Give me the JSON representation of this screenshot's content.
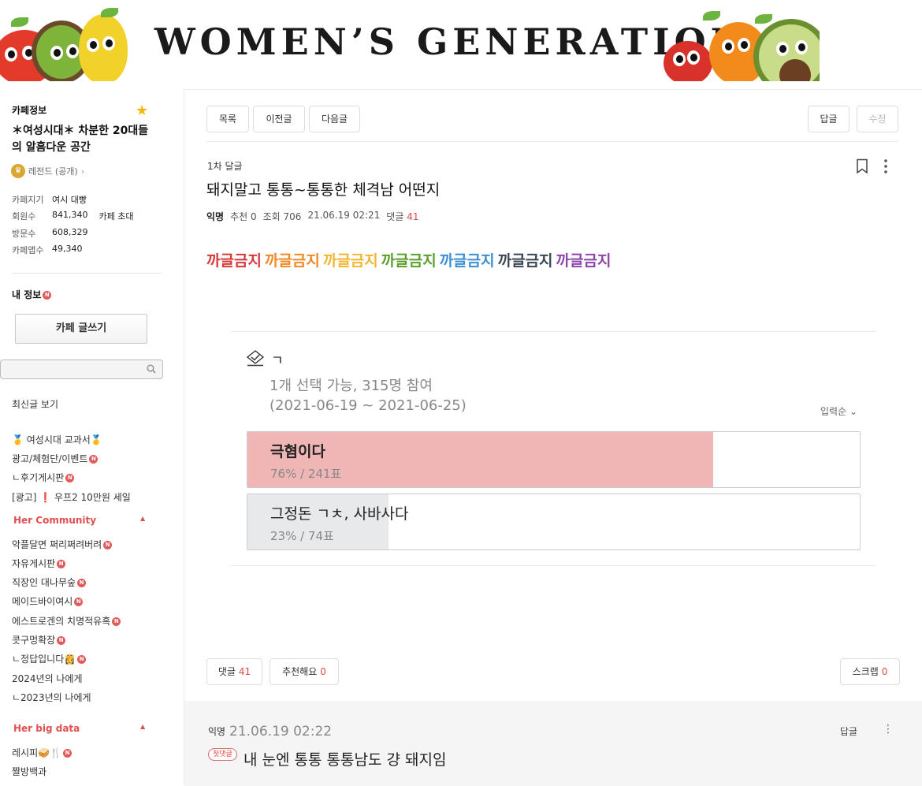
{
  "banner": {
    "title": "WOMEN’S GENERATION"
  },
  "sidebar": {
    "cafe_info_title": "카페정보",
    "cafe_desc": "＊여성시대＊ 차분한 20대들의 알흠다운 공간",
    "rank": "레전드 (공개)",
    "stats": [
      {
        "key": "카페지기",
        "value": "여시 대빵",
        "extra": ""
      },
      {
        "key": "회원수",
        "value": "841,340",
        "extra": "카페 초대"
      },
      {
        "key": "방문수",
        "value": "608,329",
        "extra": ""
      },
      {
        "key": "카페앱수",
        "value": "49,340",
        "extra": ""
      }
    ],
    "my_info": "내 정보",
    "write_button": "카페 글쓰기",
    "search_placeholder": "",
    "recent_posts": "최신글 보기",
    "links_top": [
      "🥇 여성시대 교과서🥇",
      "광고/체험단/이벤트",
      "ㄴ후기게시판",
      "[광고] ❗ 우프2 10만원 세일"
    ],
    "group1": "Her Community",
    "links_community": [
      "악플달면 쩌리쩌려버려",
      "자유게시판",
      "직장인 대나무숲",
      "메이드바이여시",
      "에스트로겐의 치명적유혹",
      "콧구멍확장",
      "ㄴ정답입니다👸",
      "2024년의 나에게",
      "ㄴ2023년의 나에게"
    ],
    "group2": "Her big data",
    "links_bigdata": [
      "레시피🥪🍴",
      "짤방백과"
    ]
  },
  "toolbar": {
    "list": "목록",
    "prev": "이전글",
    "next": "다음글",
    "reply": "답글",
    "edit": "수정"
  },
  "post": {
    "board": "1차 달글",
    "title": "돼지말고 통통~통통한 체격남 어떤지",
    "author": "익명",
    "recommend": "추천 0",
    "views": "조회 706",
    "date": "21.06.19 02:21",
    "comments_label": "댓글",
    "comments_count": "41",
    "rainbow": [
      {
        "text": "까글금지",
        "color": "#d9383a"
      },
      {
        "text": "까글금지",
        "color": "#f08a24"
      },
      {
        "text": "까글금지",
        "color": "#f2b630"
      },
      {
        "text": "까글금지",
        "color": "#5a9e2d"
      },
      {
        "text": "까글금지",
        "color": "#3b8fd6"
      },
      {
        "text": "까글금지",
        "color": "#3a4653"
      },
      {
        "text": "까글금지",
        "color": "#8e44ad"
      }
    ]
  },
  "poll": {
    "question": "ㄱ",
    "info": "1개 선택 가능, 315명 참여",
    "period": "(2021-06-19 ~ 2021-06-25)",
    "sort": "입력순",
    "options": [
      {
        "label": "극혐이다",
        "result": "76% / 241표",
        "percent": 76,
        "fill": "#f0b6b6",
        "bold": true
      },
      {
        "label": "그정돈 ㄱㅊ, 사바사다",
        "result": "23% / 74표",
        "percent": 23,
        "fill": "#e8e9eb",
        "bold": false
      }
    ]
  },
  "footer": {
    "comments_label": "댓글",
    "comments_count": "41",
    "recommend_label": "추천해요",
    "recommend_count": "0",
    "scrap_label": "스크랩",
    "scrap_count": "0"
  },
  "comment": {
    "author": "익명",
    "date": "21.06.19 02:22",
    "reply": "답글",
    "badge": "첫댓글",
    "text": "내 눈엔 통통 통통남도 걍 돼지임"
  }
}
